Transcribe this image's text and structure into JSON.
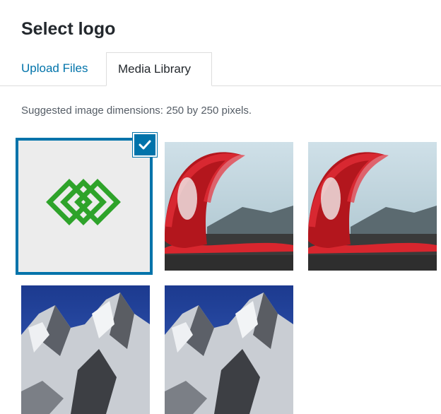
{
  "modal": {
    "title": "Select logo"
  },
  "tabs": [
    {
      "label": "Upload Files",
      "active": false
    },
    {
      "label": "Media Library",
      "active": true
    }
  ],
  "hint": "Suggested image dimensions: 250 by 250 pixels.",
  "colors": {
    "accent": "#0073aa",
    "logo_green": "#2ea32a"
  },
  "attachments": [
    {
      "kind": "logo",
      "selected": true
    },
    {
      "kind": "lava",
      "selected": false
    },
    {
      "kind": "lava",
      "selected": false
    },
    {
      "kind": "mountain",
      "selected": false
    },
    {
      "kind": "mountain",
      "selected": false
    }
  ]
}
